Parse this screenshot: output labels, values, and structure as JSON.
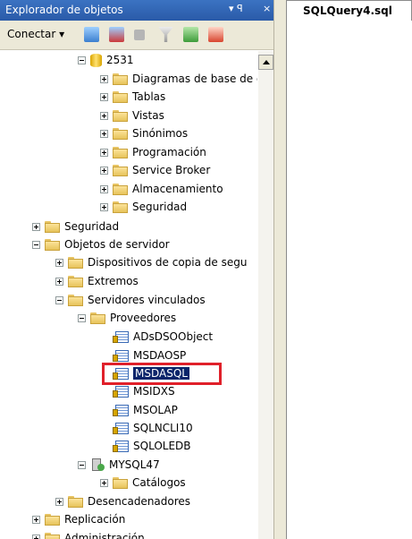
{
  "titlebar": {
    "title": "Explorador de objetos",
    "pin": "▾ ꟼ",
    "close": "×"
  },
  "toolbar": {
    "connect_label": "Conectar ▾"
  },
  "tab": {
    "title": "SQLQuery4.sql -..."
  },
  "tree": [
    {
      "label": "2531",
      "level": 2,
      "exp": "minus",
      "icon": "db"
    },
    {
      "label": "Diagramas de base de dat",
      "level": 3,
      "exp": "plus",
      "icon": "folder"
    },
    {
      "label": "Tablas",
      "level": 3,
      "exp": "plus",
      "icon": "folder"
    },
    {
      "label": "Vistas",
      "level": 3,
      "exp": "plus",
      "icon": "folder"
    },
    {
      "label": "Sinónimos",
      "level": 3,
      "exp": "plus",
      "icon": "folder"
    },
    {
      "label": "Programación",
      "level": 3,
      "exp": "plus",
      "icon": "folder"
    },
    {
      "label": "Service Broker",
      "level": 3,
      "exp": "plus",
      "icon": "folder"
    },
    {
      "label": "Almacenamiento",
      "level": 3,
      "exp": "plus",
      "icon": "folder"
    },
    {
      "label": "Seguridad",
      "level": 3,
      "exp": "plus",
      "icon": "folder"
    },
    {
      "label": "Seguridad",
      "level": 0,
      "exp": "plus",
      "icon": "folder"
    },
    {
      "label": "Objetos de servidor",
      "level": 0,
      "exp": "minus",
      "icon": "folder"
    },
    {
      "label": "Dispositivos de copia de segu",
      "level": 1,
      "exp": "plus",
      "icon": "folder"
    },
    {
      "label": "Extremos",
      "level": 1,
      "exp": "plus",
      "icon": "folder"
    },
    {
      "label": "Servidores vinculados",
      "level": 1,
      "exp": "minus",
      "icon": "folder"
    },
    {
      "label": "Proveedores",
      "level": 2,
      "exp": "minus",
      "icon": "folder"
    },
    {
      "label": "ADsDSOObject",
      "level": 3,
      "exp": "none",
      "icon": "prov"
    },
    {
      "label": "MSDAOSP",
      "level": 3,
      "exp": "none",
      "icon": "prov"
    },
    {
      "label": "MSDASQL",
      "level": 3,
      "exp": "none",
      "icon": "prov",
      "selected": true
    },
    {
      "label": "MSIDXS",
      "level": 3,
      "exp": "none",
      "icon": "prov"
    },
    {
      "label": "MSOLAP",
      "level": 3,
      "exp": "none",
      "icon": "prov"
    },
    {
      "label": "SQLNCLI10",
      "level": 3,
      "exp": "none",
      "icon": "prov"
    },
    {
      "label": "SQLOLEDB",
      "level": 3,
      "exp": "none",
      "icon": "prov"
    },
    {
      "label": "MYSQL47",
      "level": 2,
      "exp": "minus",
      "icon": "server"
    },
    {
      "label": "Catálogos",
      "level": 3,
      "exp": "plus",
      "icon": "folder"
    },
    {
      "label": "Desencadenadores",
      "level": 1,
      "exp": "plus",
      "icon": "folder"
    },
    {
      "label": "Replicación",
      "level": 0,
      "exp": "plus",
      "icon": "folder"
    },
    {
      "label": "Administración",
      "level": 0,
      "exp": "plus",
      "icon": "folder"
    }
  ],
  "colors": {
    "titlebar": "#2a5aa8",
    "selection": "#0a246a",
    "highlight_box": "#e0202a"
  }
}
